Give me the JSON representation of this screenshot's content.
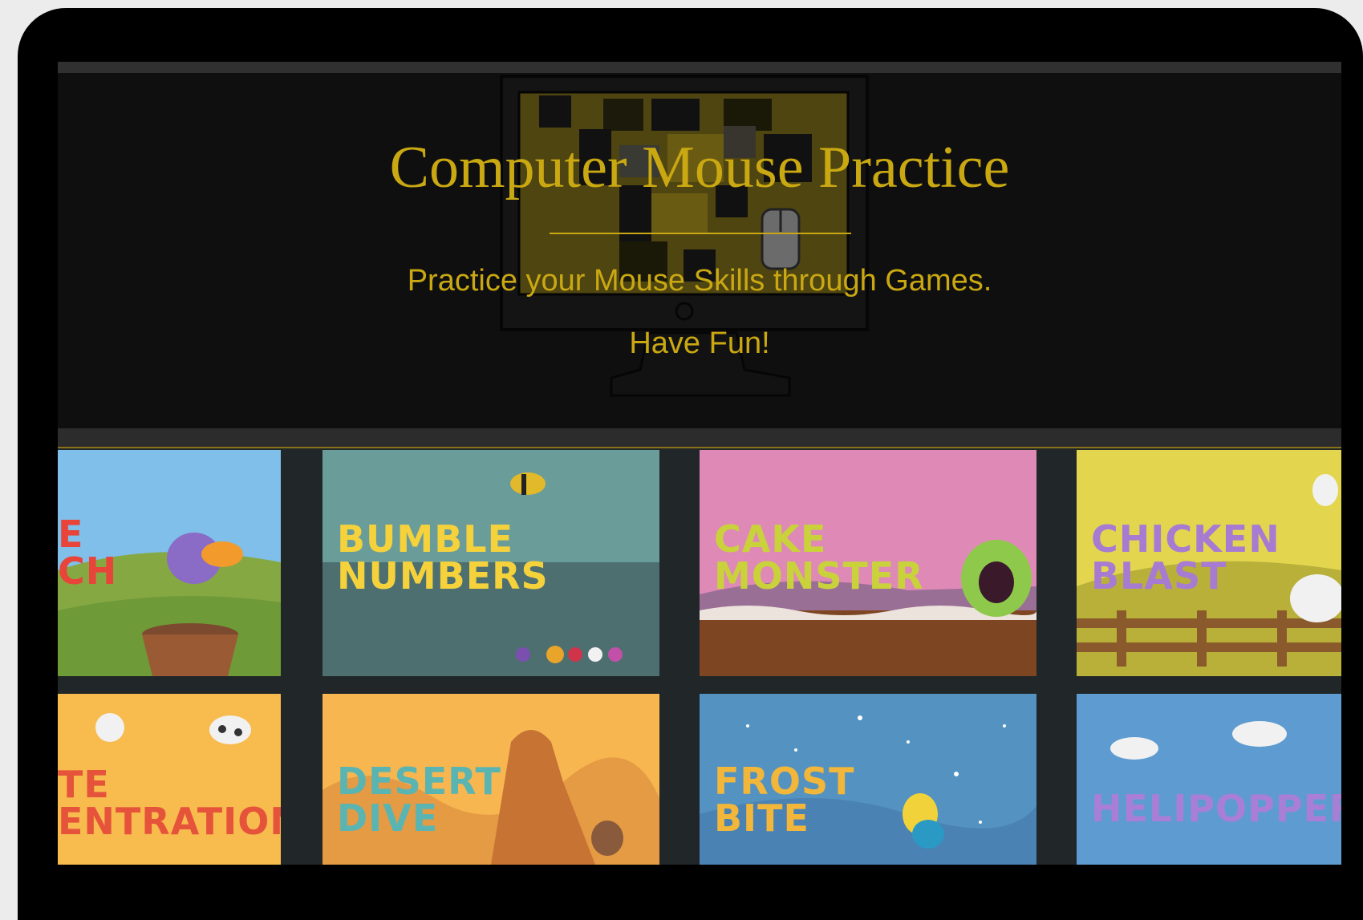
{
  "hero": {
    "title": "Computer Mouse Practice",
    "subtitle": "Practice your Mouse Skills through Games.",
    "tagline": "Have Fun!",
    "accent_color": "#c9a812"
  },
  "games": [
    {
      "label": "E\nCH",
      "label_color": "#e8443a",
      "bg": "#7fbfe9"
    },
    {
      "label": "BUMBLE\nNUMBERS",
      "label_color": "#f5d23c",
      "bg": "#6a9c99"
    },
    {
      "label": "CAKE\nMONSTER",
      "label_color": "#c9d23a",
      "bg": "#df89b6"
    },
    {
      "label": "CHICKEN\nBLAST",
      "label_color": "#a77bd2",
      "bg": "#e3d64e"
    },
    {
      "label": "TE\nENTRATION",
      "label_color": "#e6533b",
      "bg": "#f7bb4e"
    },
    {
      "label": "DESERT\nDIVE",
      "label_color": "#5ab5b2",
      "bg": "#f7b64f"
    },
    {
      "label": "FROST\nBITE",
      "label_color": "#f2b63a",
      "bg": "#5392c1"
    },
    {
      "label": "HELIPOPPER",
      "label_color": "#a97fd6",
      "bg": "#5d9bd0"
    }
  ]
}
